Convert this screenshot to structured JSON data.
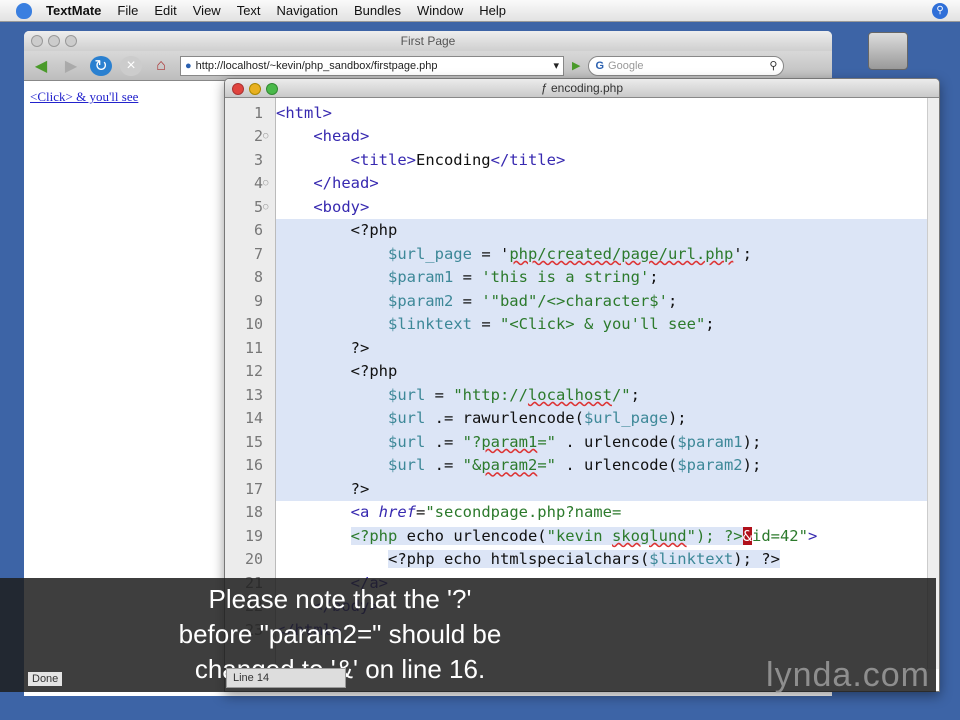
{
  "menubar": {
    "app": "TextMate",
    "items": [
      "File",
      "Edit",
      "View",
      "Text",
      "Navigation",
      "Bundles",
      "Window",
      "Help"
    ]
  },
  "browser": {
    "title": "First Page",
    "url": "http://localhost/~kevin/php_sandbox/firstpage.php",
    "search_placeholder": "Google",
    "link": "<Click> & you'll see",
    "status": "Done"
  },
  "editor": {
    "title": "encoding.php",
    "status": "Line 14",
    "lines": [
      {
        "n": "1",
        "t": [
          [
            "<html>",
            "tag"
          ]
        ]
      },
      {
        "n": "2",
        "fold": true,
        "t": [
          [
            "    ",
            ""
          ],
          [
            "<head>",
            "tag"
          ]
        ]
      },
      {
        "n": "3",
        "t": [
          [
            "        ",
            ""
          ],
          [
            "<title>",
            "tag"
          ],
          [
            "Encoding",
            "plain"
          ],
          [
            "</title>",
            "tag"
          ]
        ]
      },
      {
        "n": "4",
        "fold": true,
        "t": [
          [
            "    ",
            ""
          ],
          [
            "</head>",
            "tag"
          ]
        ]
      },
      {
        "n": "5",
        "fold": true,
        "t": [
          [
            "    ",
            ""
          ],
          [
            "<body>",
            "tag"
          ]
        ]
      },
      {
        "n": "6",
        "sel": true,
        "t": [
          [
            "        ",
            ""
          ],
          [
            "<?php",
            "plain"
          ]
        ]
      },
      {
        "n": "7",
        "sel": true,
        "t": [
          [
            "            ",
            ""
          ],
          [
            "$url_page",
            "var"
          ],
          [
            " = '",
            "plain"
          ],
          [
            "php/created/page/url.php",
            "str spell"
          ],
          [
            "';",
            "plain"
          ]
        ]
      },
      {
        "n": "8",
        "sel": true,
        "t": [
          [
            "            ",
            ""
          ],
          [
            "$param1",
            "var"
          ],
          [
            " = ",
            "plain"
          ],
          [
            "'this is a string'",
            "str"
          ],
          [
            ";",
            "plain"
          ]
        ]
      },
      {
        "n": "9",
        "sel": true,
        "t": [
          [
            "            ",
            ""
          ],
          [
            "$param2",
            "var"
          ],
          [
            " = ",
            "plain"
          ],
          [
            "'\"bad\"/<>character$'",
            "str"
          ],
          [
            ";",
            "plain"
          ]
        ]
      },
      {
        "n": "10",
        "sel": true,
        "t": [
          [
            "            ",
            ""
          ],
          [
            "$linktext",
            "var"
          ],
          [
            " = ",
            "plain"
          ],
          [
            "\"<Click> & you'll see\"",
            "str"
          ],
          [
            ";",
            "plain"
          ]
        ]
      },
      {
        "n": "11",
        "sel": true,
        "t": [
          [
            "        ",
            ""
          ],
          [
            "?>",
            "plain"
          ]
        ]
      },
      {
        "n": "12",
        "sel": true,
        "t": [
          [
            "        ",
            ""
          ],
          [
            "<?php",
            "plain"
          ]
        ]
      },
      {
        "n": "13",
        "sel": true,
        "t": [
          [
            "            ",
            ""
          ],
          [
            "$url",
            "var"
          ],
          [
            " = ",
            "plain"
          ],
          [
            "\"http://",
            "str"
          ],
          [
            "localhost",
            "str spell"
          ],
          [
            "/\"",
            "str"
          ],
          [
            ";",
            "plain"
          ]
        ]
      },
      {
        "n": "14",
        "sel": true,
        "t": [
          [
            "            ",
            ""
          ],
          [
            "$url",
            "var"
          ],
          [
            " .= rawurlencode(",
            "plain"
          ],
          [
            "$url_page",
            "var"
          ],
          [
            ");",
            "plain"
          ]
        ]
      },
      {
        "n": "15",
        "sel": true,
        "t": [
          [
            "            ",
            ""
          ],
          [
            "$url",
            "var"
          ],
          [
            " .= ",
            "plain"
          ],
          [
            "\"?",
            "str"
          ],
          [
            "param1",
            "str spell"
          ],
          [
            "=\"",
            "str"
          ],
          [
            " . urlencode(",
            "plain"
          ],
          [
            "$param1",
            "var"
          ],
          [
            ");",
            "plain"
          ]
        ]
      },
      {
        "n": "16",
        "sel": true,
        "t": [
          [
            "            ",
            ""
          ],
          [
            "$url",
            "var"
          ],
          [
            " .= ",
            "plain"
          ],
          [
            "\"&",
            "str"
          ],
          [
            "param2",
            "str spell"
          ],
          [
            "=\"",
            "str"
          ],
          [
            " . urlencode(",
            "plain"
          ],
          [
            "$param2",
            "var"
          ],
          [
            ");",
            "plain"
          ]
        ]
      },
      {
        "n": "17",
        "sel": true,
        "t": [
          [
            "        ",
            ""
          ],
          [
            "?>",
            "plain"
          ]
        ]
      },
      {
        "n": "18",
        "t": [
          [
            "        ",
            ""
          ],
          [
            "<a ",
            "tag"
          ],
          [
            "href",
            "attr"
          ],
          [
            "=",
            "plain"
          ],
          [
            "\"secondpage.php?name=",
            "str"
          ]
        ]
      },
      {
        "n": "19",
        "t": [
          [
            "        ",
            ""
          ],
          [
            "<?php",
            "php hl"
          ],
          [
            " echo urlencode(",
            "plain hl"
          ],
          [
            "\"kevin ",
            "str hl"
          ],
          [
            "skoglund",
            "str hl spell"
          ],
          [
            "\"",
            "str hl"
          ],
          [
            "); ?>",
            "php hl"
          ],
          [
            "&",
            "cursor"
          ],
          [
            "id=42\"",
            "str"
          ],
          [
            ">",
            "tag"
          ]
        ]
      },
      {
        "n": "20",
        "t": [
          [
            "            ",
            ""
          ],
          [
            "<?php echo htmlspecialchars(",
            "plain hl"
          ],
          [
            "$linktext",
            "var hl"
          ],
          [
            "); ?>",
            "plain hl"
          ]
        ]
      },
      {
        "n": "21",
        "t": [
          [
            "        ",
            ""
          ],
          [
            "</a>",
            "tag"
          ]
        ]
      },
      {
        "n": "22",
        "fold": true,
        "t": [
          [
            "    ",
            ""
          ],
          [
            "</body>",
            "tag"
          ]
        ]
      },
      {
        "n": "23",
        "t": [
          [
            "</html>",
            "tag"
          ]
        ]
      }
    ]
  },
  "caption": {
    "line1": "Please note that the '?'",
    "line2": "before \"param2=\" should be",
    "line3": "changed to '&' on line 16."
  },
  "watermark": "lynda.com"
}
